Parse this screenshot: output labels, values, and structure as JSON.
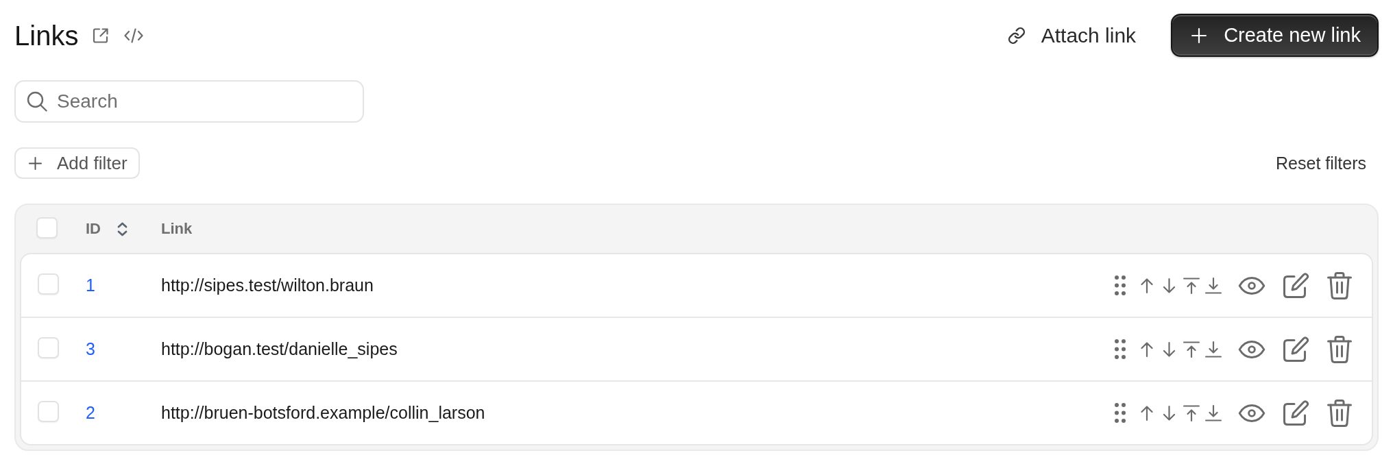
{
  "page": {
    "title": "Links"
  },
  "actions": [
    {
      "kind": "attach",
      "label": "Attach link"
    },
    {
      "kind": "create",
      "label": "Create new link"
    }
  ],
  "search": {
    "placeholder": "Search"
  },
  "filters": {
    "add_label": "Add filter",
    "reset_label": "Reset filters"
  },
  "table": {
    "select_all": {
      "checked": false
    },
    "columns": [
      {
        "label": "ID",
        "sortable": true
      },
      {
        "label": "Link",
        "sortable": false
      }
    ],
    "rows": [
      {
        "id": "1",
        "link": "http://sipes.test/wilton.braun",
        "checked": false
      },
      {
        "id": "3",
        "link": "http://bogan.test/danielle_sipes",
        "checked": false
      },
      {
        "id": "2",
        "link": "http://bruen-botsford.example/collin_larson",
        "checked": false
      }
    ]
  }
}
